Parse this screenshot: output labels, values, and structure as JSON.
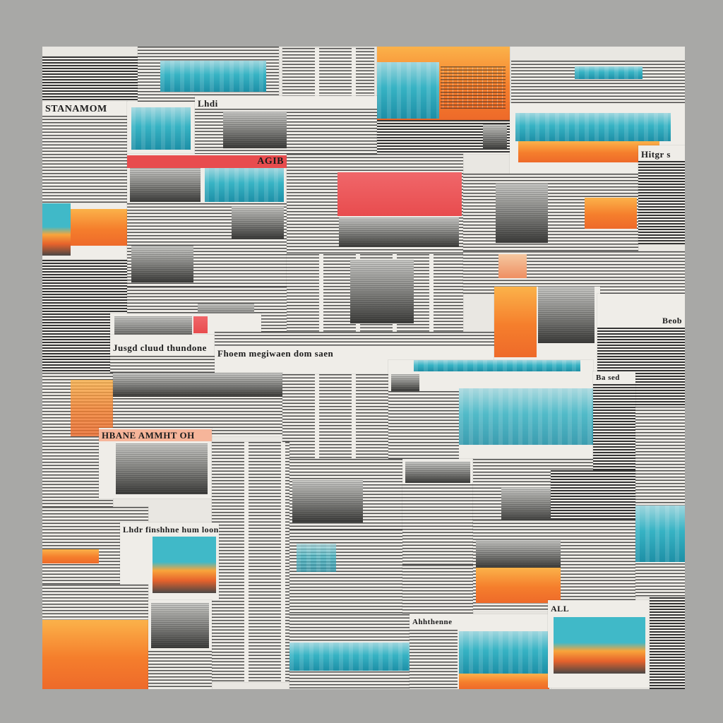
{
  "collage": {
    "headlines": [
      "STANAMOM",
      "Lhdi",
      "AGIB",
      "Jusgd cluud thundone",
      "Fhoem megiwaen dom saen",
      "HBANE AMMHT OH",
      "Lhdr finshhne hum loon",
      "Hitgr s",
      "Beob",
      "Ba sed",
      "ALL",
      "Ahhthenne"
    ],
    "accent_colors": {
      "teal": "#37b3c4",
      "orange": "#f57e2c",
      "red": "#e84c4e",
      "background": "#a8a8a6"
    }
  }
}
